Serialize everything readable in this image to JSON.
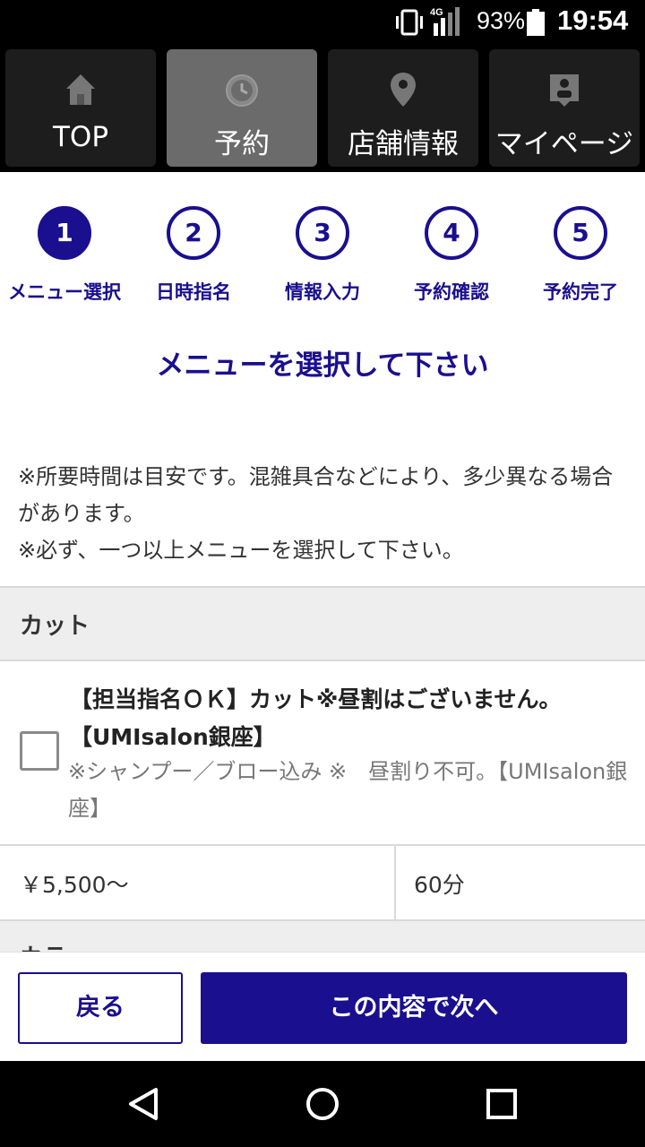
{
  "status_bar": {
    "network": "4G",
    "battery_percent": "93%",
    "time": "19:54",
    "icons": [
      "vibrate-icon",
      "signal-icon",
      "battery-icon"
    ]
  },
  "top_nav": {
    "items": [
      {
        "label": "TOP",
        "icon": "home-icon",
        "active": false
      },
      {
        "label": "予約",
        "icon": "clock-icon",
        "active": true
      },
      {
        "label": "店舗情報",
        "icon": "map-pin-icon",
        "active": false
      },
      {
        "label": "マイページ",
        "icon": "user-card-icon",
        "active": false
      }
    ]
  },
  "steps": [
    {
      "number": "1",
      "label": "メニュー選択",
      "active": true
    },
    {
      "number": "2",
      "label": "日時指名",
      "active": false
    },
    {
      "number": "3",
      "label": "情報入力",
      "active": false
    },
    {
      "number": "4",
      "label": "予約確認",
      "active": false
    },
    {
      "number": "5",
      "label": "予約完了",
      "active": false
    }
  ],
  "heading": "メニューを選択して下さい",
  "notes": [
    "※所要時間は目安です。混雑具合などにより、多少異なる場合があります。",
    "※必ず、一つ以上メニューを選択して下さい。"
  ],
  "section": {
    "title": "カット",
    "next_title": "カラー"
  },
  "menu_item": {
    "title": "【担当指名ＯＫ】カット※昼割はございません。【UMIsalon銀座】",
    "description": "※シャンプー／ブロー込み ※　昼割り不可。【UMIsalon銀座】",
    "price": "￥5,500〜",
    "duration": "60分",
    "checked": false
  },
  "buttons": {
    "back": "戻る",
    "next": "この内容で次へ"
  },
  "colors": {
    "accent": "#1a0f8f",
    "nav_active": "#6b6b6b",
    "section_bg": "#eeeeee"
  }
}
